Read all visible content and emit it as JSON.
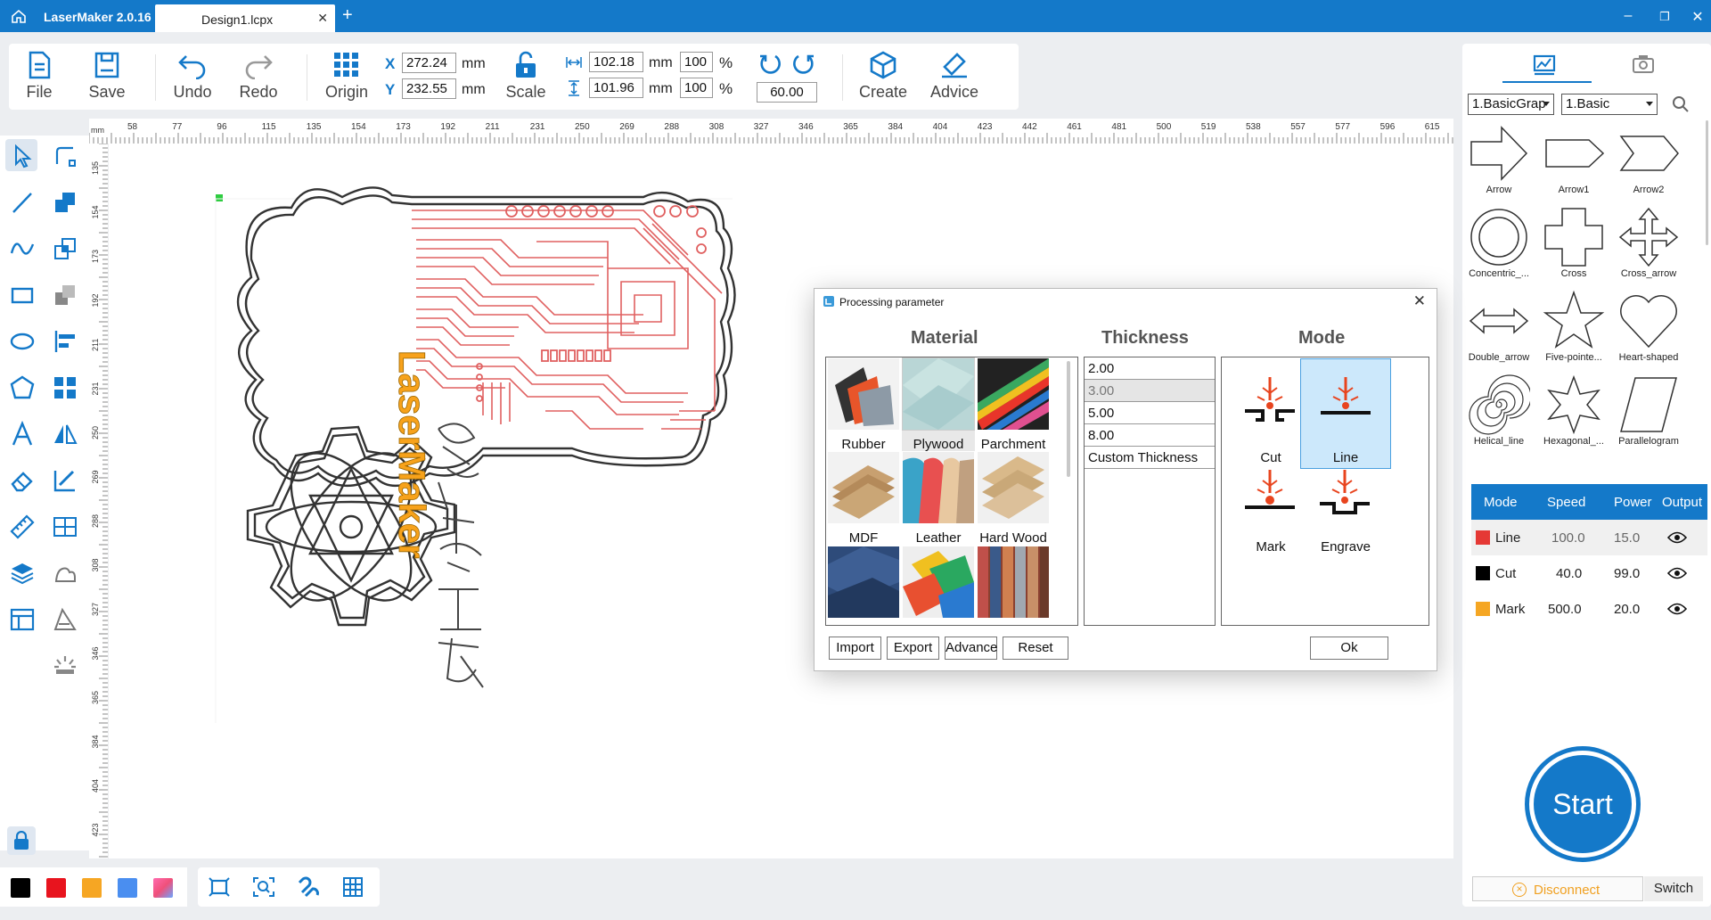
{
  "app": {
    "title": "LaserMaker 2.0.16",
    "tab": "Design1.lcpx"
  },
  "toolbar": {
    "file": "File",
    "save": "Save",
    "undo": "Undo",
    "redo": "Redo",
    "origin": "Origin",
    "scale": "Scale",
    "create": "Create",
    "advice": "Advice",
    "x_label": "X",
    "y_label": "Y",
    "x_value": "272.24",
    "y_value": "232.55",
    "unit": "mm",
    "width_value": "102.18",
    "height_value": "101.96",
    "width_pct": "100",
    "height_pct": "100",
    "pct": "%",
    "rotation": "60.00"
  },
  "ruler": {
    "h_labels": [
      "58",
      "77",
      "96",
      "115",
      "135",
      "154",
      "173",
      "192",
      "211",
      "231",
      "250",
      "269",
      "288",
      "308",
      "327",
      "346",
      "365",
      "384",
      "404",
      "423",
      "442",
      "461",
      "481",
      "500",
      "519",
      "538",
      "557",
      "577",
      "596",
      "615"
    ],
    "v_labels": [
      "135",
      "154",
      "173",
      "192",
      "211",
      "231",
      "250",
      "269",
      "288",
      "308",
      "327",
      "346",
      "365",
      "384",
      "404",
      "423"
    ],
    "unit": "mm"
  },
  "right_panel": {
    "select_category": "1.BasicGrap",
    "select_sub": "1.Basic",
    "shapes": [
      "Arrow",
      "Arrow1",
      "Arrow2",
      "Concentric_...",
      "Cross",
      "Cross_arrow",
      "Double_arrow",
      "Five-pointe...",
      "Heart-shaped",
      "Helical_line",
      "Hexagonal_...",
      "Parallelogram"
    ],
    "layers": {
      "headers": [
        "Mode",
        "Speed",
        "Power",
        "Output"
      ],
      "rows": [
        {
          "mode": "Line",
          "speed": "100.0",
          "power": "15.0",
          "color": "#e53935"
        },
        {
          "mode": "Cut",
          "speed": "40.0",
          "power": "99.0",
          "color": "#000000"
        },
        {
          "mode": "Mark",
          "speed": "500.0",
          "power": "20.0",
          "color": "#f5a623"
        }
      ]
    },
    "start": "Start",
    "disconnect": "Disconnect",
    "switch": "Switch"
  },
  "dialog": {
    "title": "Processing parameter",
    "material_head": "Material",
    "thickness_head": "Thickness",
    "mode_head": "Mode",
    "materials": [
      "Rubber",
      "Plywood",
      "Parchment",
      "MDF",
      "Leather",
      "Hard Wood"
    ],
    "thickness": [
      "2.00",
      "3.00",
      "5.00",
      "8.00",
      "Custom Thickness"
    ],
    "modes": [
      "Cut",
      "Line",
      "Mark",
      "Engrave"
    ],
    "buttons": {
      "import": "Import",
      "export": "Export",
      "advance": "Advance",
      "reset": "Reset",
      "ok": "Ok"
    }
  },
  "canvas": {
    "logo_text": "LaserMaker"
  },
  "colors": {
    "accent": "#1479c9",
    "trace": "#e06060",
    "palette": [
      "#000000",
      "#e8141e",
      "#f6a623",
      "#4a8ef0",
      "#ff6bb0"
    ]
  }
}
